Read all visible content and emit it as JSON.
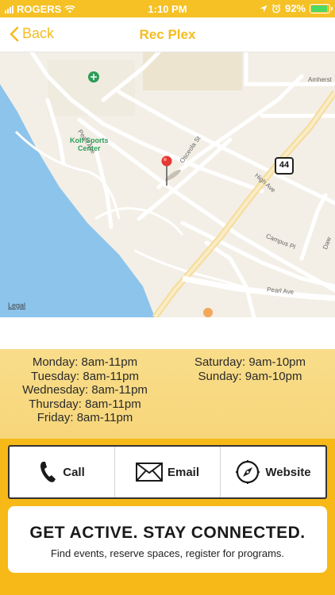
{
  "status": {
    "carrier": "ROGERS",
    "time": "1:10 PM",
    "battery": "92%",
    "battery_level": 0.92
  },
  "nav": {
    "back_label": "Back",
    "title": "Rec Plex"
  },
  "map": {
    "poi_name": "Kolf Sports Center",
    "poi_line1": "Kolf Sports",
    "poi_line2": "Center",
    "streets": {
      "pearl_ave": "Pearl Ave",
      "osceola_st": "Osceola St",
      "high_ave": "High Ave",
      "campus_pl": "Campus Pl",
      "pearl_ave_2": "Pearl Ave",
      "amherst": "Amherst",
      "daw": "Daw"
    },
    "highway": "44",
    "legal": "Legal"
  },
  "hours": {
    "weekdays": [
      "Monday: 8am-11pm",
      "Tuesday: 8am-11pm",
      "Wednesday: 8am-11pm",
      "Thursday: 8am-11pm",
      "Friday: 8am-11pm"
    ],
    "weekend": [
      "Saturday: 9am-10pm",
      "Sunday: 9am-10pm"
    ]
  },
  "actions": {
    "call": "Call",
    "email": "Email",
    "website": "Website"
  },
  "promo": {
    "title": "GET ACTIVE. STAY CONNECTED.",
    "subtitle": "Find events, reserve spaces, register for programs."
  },
  "colors": {
    "accent": "#f3bd1f",
    "status_bar": "#f5c125",
    "hours_bg": "#f8d982",
    "lower_bg": "#f6b917",
    "water": "#8cc4ec",
    "pin": "#e53935",
    "poi": "#2e9c59"
  }
}
